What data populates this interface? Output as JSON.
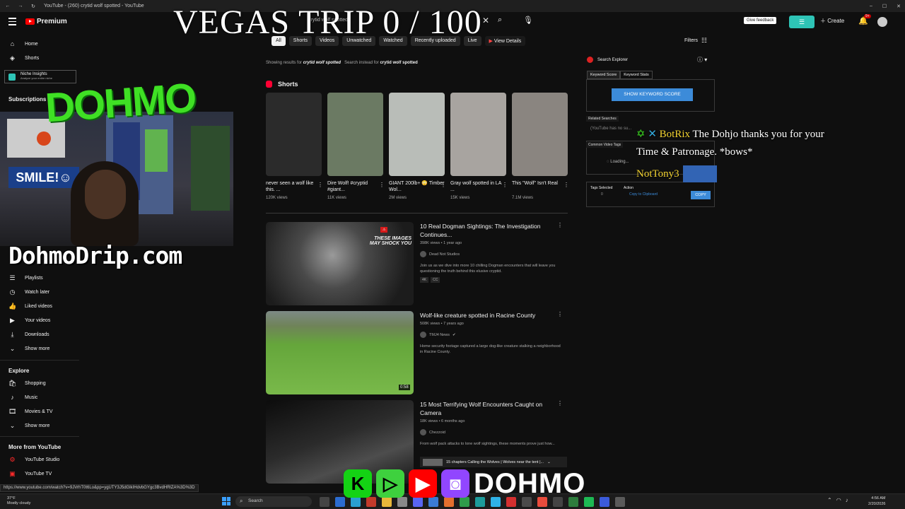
{
  "browser": {
    "tab_title": "YouTube - (260) crytid wolf spotted - YouTube"
  },
  "header": {
    "logo_text": "Premium",
    "search_query": "crytid wolf spotted",
    "feedback_label": "Give feedback",
    "create_label": "Create",
    "notification_count": "9+"
  },
  "overlay": {
    "title": "VEGAS TRIP 0 / 100",
    "graffiti": "DOHMO",
    "url": "DohmoDrip.com",
    "webcam_sign": "SMILE!☺",
    "chat1_name": "BotRix",
    "chat1_text": "The Dohjo thanks you for your",
    "chat2_text": "Time & Patronage. *bows*",
    "chat3_name": "NotTony3",
    "banner_name": "DOHMO"
  },
  "sidebar": {
    "top_items": [
      {
        "label": "Home",
        "icon": "home-icon"
      },
      {
        "label": "Shorts",
        "icon": "shorts-icon"
      }
    ],
    "niche_title": "Niche Insights",
    "niche_sub": "Analyze your entire niche",
    "subscriptions_label": "Subscriptions",
    "you_items": [
      {
        "label": "Playlists",
        "icon": "playlist-icon"
      },
      {
        "label": "Watch later",
        "icon": "clock-icon"
      },
      {
        "label": "Liked videos",
        "icon": "thumbs-up-icon"
      },
      {
        "label": "Your videos",
        "icon": "play-square-icon"
      },
      {
        "label": "Downloads",
        "icon": "download-icon"
      },
      {
        "label": "Show more",
        "icon": "chevron-down-icon"
      }
    ],
    "explore_label": "Explore",
    "explore_items": [
      {
        "label": "Shopping",
        "icon": "bag-icon"
      },
      {
        "label": "Music",
        "icon": "music-icon"
      },
      {
        "label": "Movies & TV",
        "icon": "film-icon"
      },
      {
        "label": "Show more",
        "icon": "chevron-down-icon"
      }
    ],
    "more_label": "More from YouTube",
    "more_items": [
      {
        "label": "YouTube Studio",
        "icon": "studio-icon"
      },
      {
        "label": "YouTube TV",
        "icon": "youtube-tv-icon"
      }
    ]
  },
  "chips": [
    "All",
    "Shorts",
    "Videos",
    "Unwatched",
    "Watched",
    "Recently uploaded",
    "Live"
  ],
  "view_details": "View Details",
  "filters_label": "Filters",
  "results": {
    "showing_prefix": "Showing results for",
    "query": "crytid wolf spotted",
    "instead_prefix": "Search instead for",
    "instead_query": "crytid wolf spotted"
  },
  "shorts": {
    "heading": "Shorts",
    "items": [
      {
        "title": "never seen a wolf like this. ...",
        "views": "120K views",
        "color": "#2b2b2b"
      },
      {
        "title": "Dire Wolf! #cryptid #giant...",
        "views": "11K views",
        "color": "#6b7a63"
      },
      {
        "title": "GIANT 200lb+ 😳 Timber Wol...",
        "views": "2M views",
        "color": "#b9bdb8"
      },
      {
        "title": "Gray wolf spotted in LA ...",
        "views": "15K views",
        "color": "#a8a4a0"
      },
      {
        "title": "This \"Wolf\" Isn't Real",
        "views": "7.1M views",
        "color": "#8a8580"
      }
    ]
  },
  "videos": [
    {
      "title": "10 Real Dogman Sightings: The Investigation Continues...",
      "meta": "398K views • 1 year ago",
      "channel": "Dead Not Studios",
      "desc": "Join us as we dive into more 10 chilling Dogman encounters that will leave you questioning the truth behind this elusive cryptid.",
      "badges": [
        "4K",
        "CC"
      ],
      "duration": "",
      "thumb_text": "THESE IMAGES MAY SHOCK YOU",
      "thumb_color": "#3d3d3d"
    },
    {
      "title": "Wolf-like creature spotted in Racine County",
      "meta": "508K views • 7 years ago",
      "channel": "TMJ4 News",
      "desc": "Home security footage captured a large dog-like creature stalking a neighborhood in Racine County.",
      "badges": [],
      "duration": "0:58",
      "thumb_text": "",
      "thumb_color": "#5a8a3a"
    },
    {
      "title": "15 Most Terrifying Wolf Encounters Caught on Camera",
      "meta": "18K views • 6 months ago",
      "channel": "Chezzoid",
      "desc": "From wolf pack attacks to lone wolf sightings, these moments prove just how...",
      "badges": [],
      "duration": "",
      "thumb_text": "",
      "thumb_color": "#2a2a2a"
    }
  ],
  "chapters_text": "15 chapters  Calling the Wolves | Wolves near the tent |...",
  "extension": {
    "title": "Search Explorer",
    "tab_score": "Keyword Score",
    "tab_stats": "Keyword Stats",
    "button": "SHOW KEYWORD SCORE",
    "related": "Related Searches",
    "related_placeholder": "(YouTube has no su...",
    "common_tags": "Common Video Tags",
    "loading": "Loading...",
    "tags_selected": "Tags Selected",
    "action": "Action",
    "tags_count": "0",
    "copy_clipboard": "Copy to Clipboard",
    "copy_btn": "COPY"
  },
  "status_url": "https://www.youtube.com/watch?v=9JVrhT0t6Lo&pp=ygUTY3J5dGlkIHdvbGYgc3BvdHRlZA%3D%3D",
  "taskbar": {
    "temp": "37°F",
    "weather": "Mostly cloudy",
    "search": "Search",
    "time": "4:56 AM",
    "date": "2/20/2026"
  }
}
